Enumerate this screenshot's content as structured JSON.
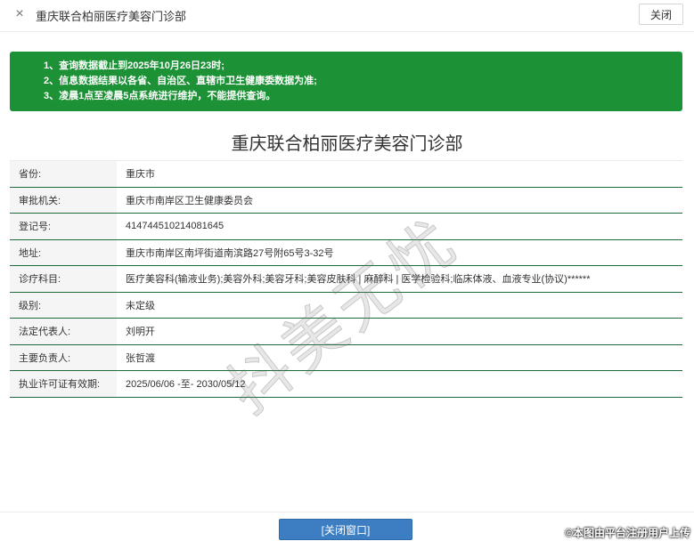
{
  "window": {
    "title": "重庆联合柏丽医疗美容门诊部",
    "close_icon": "×",
    "close_label": "关闭"
  },
  "notice": {
    "lines": [
      "1、查询数据截止到2025年10月26日23时;",
      "2、信息数据结果以各省、自治区、直辖市卫生健康委数据为准;",
      "3、凌晨1点至凌晨5点系统进行维护，不能提供查询。"
    ],
    "background": "#1c9136"
  },
  "org_name": "重庆联合柏丽医疗美容门诊部",
  "fields": [
    {
      "label": "省份:",
      "value": "重庆市"
    },
    {
      "label": "审批机关:",
      "value": "重庆市南岸区卫生健康委员会"
    },
    {
      "label": "登记号:",
      "value": "414744510214081645"
    },
    {
      "label": "地址:",
      "value": "重庆市南岸区南坪街道南滨路27号附65号3-32号"
    },
    {
      "label": "诊疗科目:",
      "value": "医疗美容科(输液业务);美容外科;美容牙科;美容皮肤科 | 麻醉科 | 医学检验科;临床体液、血液专业(协议)******"
    },
    {
      "label": "级别:",
      "value": "未定级"
    },
    {
      "label": "法定代表人:",
      "value": "刘明开"
    },
    {
      "label": "主要负责人:",
      "value": "张哲渡"
    },
    {
      "label": "执业许可证有效期:",
      "value": "2025/06/06 -至- 2030/05/12"
    }
  ],
  "watermark": "抖美无忧",
  "footer": {
    "close_window_label": "[关闭窗口]",
    "credit": "©本图由平台注册用户上传"
  }
}
